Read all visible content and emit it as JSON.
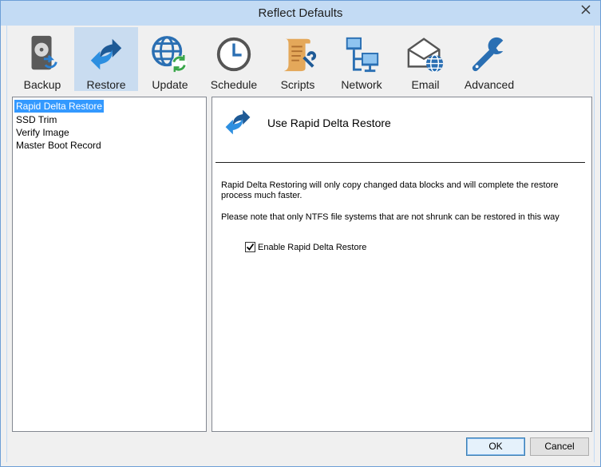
{
  "window": {
    "title": "Reflect Defaults"
  },
  "toolbar": {
    "items": [
      {
        "label": "Backup",
        "icon": "backup-disk-icon",
        "active": false
      },
      {
        "label": "Restore",
        "icon": "restore-arrows-icon",
        "active": true
      },
      {
        "label": "Update",
        "icon": "update-globe-icon",
        "active": false
      },
      {
        "label": "Schedule",
        "icon": "clock-icon",
        "active": false
      },
      {
        "label": "Scripts",
        "icon": "script-scroll-icon",
        "active": false
      },
      {
        "label": "Network",
        "icon": "network-icon",
        "active": false
      },
      {
        "label": "Email",
        "icon": "email-icon",
        "active": false
      },
      {
        "label": "Advanced",
        "icon": "wrench-icon",
        "active": false
      }
    ]
  },
  "sidebar": {
    "items": [
      {
        "label": "Rapid Delta Restore",
        "selected": true
      },
      {
        "label": "SSD Trim",
        "selected": false
      },
      {
        "label": "Verify Image",
        "selected": false
      },
      {
        "label": "Master Boot Record",
        "selected": false
      }
    ]
  },
  "panel": {
    "title": "Use Rapid Delta Restore",
    "description": "Rapid Delta Restoring will only copy changed data blocks and will complete the restore process much faster.",
    "note": "Please note that only NTFS file systems that are not shrunk can be restored in this way",
    "checkbox": {
      "label": "Enable Rapid Delta Restore",
      "checked": true
    }
  },
  "buttons": {
    "ok": "OK",
    "cancel": "Cancel"
  },
  "colors": {
    "accent": "#2a6fb3",
    "selection": "#3399ff",
    "titlebar": "#c3dbf4"
  }
}
